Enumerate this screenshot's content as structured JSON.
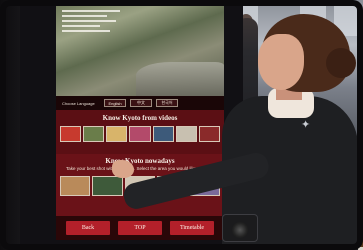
{
  "kiosk": {
    "language_label": "Choose Language",
    "language_buttons": [
      "English",
      "中文",
      "한국어"
    ],
    "section1_title": "Know Kyoto from videos",
    "section2_title": "Know Kyoto nowadays",
    "section2_subtitle": "Take your best shot with everyone. Select the area you would like to know.",
    "nav": [
      "Back",
      "TOP",
      "Timetable"
    ]
  },
  "colors": {
    "screen_bg": "#5b0f14",
    "button_red": "#b3202a",
    "coat": "#1e1f22",
    "hair": "#4a2a1a"
  }
}
